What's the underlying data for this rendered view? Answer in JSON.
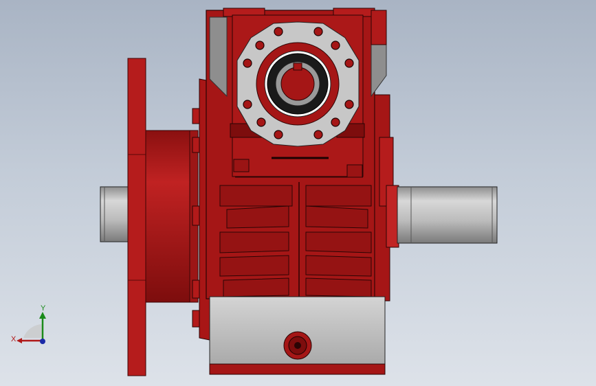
{
  "viewport": {
    "background_top": "#a9b4c4",
    "background_bottom": "#dde2e9"
  },
  "model": {
    "description_icon": "worm-gear-reducer-model",
    "body_color": "#a51616",
    "dark_red": "#6e0c0c",
    "light_red": "#c92a2a",
    "shaft_color": "#bdbdbd",
    "base_color": "#c9c9c9",
    "flange_color": "#e8e8e8"
  },
  "triad": {
    "x_label": "X",
    "y_label": "Y",
    "x_color": "#b01818",
    "y_color": "#1a8a1a",
    "z_color": "#1a2aa8"
  }
}
